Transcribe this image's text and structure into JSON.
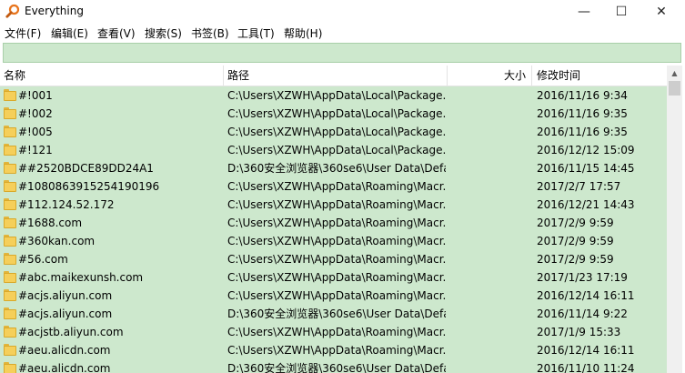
{
  "window": {
    "title": "Everything",
    "minimize_glyph": "—",
    "maximize_glyph": "☐",
    "close_glyph": "✕"
  },
  "menu": [
    {
      "label": "文件(F)"
    },
    {
      "label": "编辑(E)"
    },
    {
      "label": "查看(V)"
    },
    {
      "label": "搜索(S)"
    },
    {
      "label": "书签(B)"
    },
    {
      "label": "工具(T)"
    },
    {
      "label": "帮助(H)"
    }
  ],
  "search": {
    "value": "",
    "placeholder": ""
  },
  "columns": {
    "name": "名称",
    "path": "路径",
    "size": "大小",
    "modified": "修改时间"
  },
  "rows": [
    {
      "name": "#!001",
      "path": "C:\\Users\\XZWH\\AppData\\Local\\Package...",
      "size": "",
      "modified": "2016/11/16 9:34"
    },
    {
      "name": "#!002",
      "path": "C:\\Users\\XZWH\\AppData\\Local\\Package...",
      "size": "",
      "modified": "2016/11/16 9:35"
    },
    {
      "name": "#!005",
      "path": "C:\\Users\\XZWH\\AppData\\Local\\Package...",
      "size": "",
      "modified": "2016/11/16 9:35"
    },
    {
      "name": "#!121",
      "path": "C:\\Users\\XZWH\\AppData\\Local\\Package...",
      "size": "",
      "modified": "2016/12/12 15:09"
    },
    {
      "name": "##2520BDCE89DD24A1",
      "path": "D:\\360安全浏览器\\360se6\\User Data\\Defa...",
      "size": "",
      "modified": "2016/11/15 14:45"
    },
    {
      "name": "#1080863915254190196",
      "path": "C:\\Users\\XZWH\\AppData\\Roaming\\Macr...",
      "size": "",
      "modified": "2017/2/7 17:57"
    },
    {
      "name": "#112.124.52.172",
      "path": "C:\\Users\\XZWH\\AppData\\Roaming\\Macr...",
      "size": "",
      "modified": "2016/12/21 14:43"
    },
    {
      "name": "#1688.com",
      "path": "C:\\Users\\XZWH\\AppData\\Roaming\\Macr...",
      "size": "",
      "modified": "2017/2/9 9:59"
    },
    {
      "name": "#360kan.com",
      "path": "C:\\Users\\XZWH\\AppData\\Roaming\\Macr...",
      "size": "",
      "modified": "2017/2/9 9:59"
    },
    {
      "name": "#56.com",
      "path": "C:\\Users\\XZWH\\AppData\\Roaming\\Macr...",
      "size": "",
      "modified": "2017/2/9 9:59"
    },
    {
      "name": "#abc.maikexunsh.com",
      "path": "C:\\Users\\XZWH\\AppData\\Roaming\\Macr...",
      "size": "",
      "modified": "2017/1/23 17:19"
    },
    {
      "name": "#acjs.aliyun.com",
      "path": "C:\\Users\\XZWH\\AppData\\Roaming\\Macr...",
      "size": "",
      "modified": "2016/12/14 16:11"
    },
    {
      "name": "#acjs.aliyun.com",
      "path": "D:\\360安全浏览器\\360se6\\User Data\\Defa...",
      "size": "",
      "modified": "2016/11/14 9:22"
    },
    {
      "name": "#acjstb.aliyun.com",
      "path": "C:\\Users\\XZWH\\AppData\\Roaming\\Macr...",
      "size": "",
      "modified": "2017/1/9 15:33"
    },
    {
      "name": "#aeu.alicdn.com",
      "path": "C:\\Users\\XZWH\\AppData\\Roaming\\Macr...",
      "size": "",
      "modified": "2016/12/14 16:11"
    },
    {
      "name": "#aeu.alicdn.com",
      "path": "D:\\360安全浏览器\\360se6\\User Data\\Defa...",
      "size": "",
      "modified": "2016/11/10 11:24"
    }
  ],
  "icons": {
    "app": "magnifier-icon",
    "row": "folder-icon",
    "scroll_up": "scroll-up-arrow-icon"
  },
  "colors": {
    "selection": "#cde8cd",
    "folder": "#f5cf5a",
    "app_icon": "#e8741c"
  }
}
